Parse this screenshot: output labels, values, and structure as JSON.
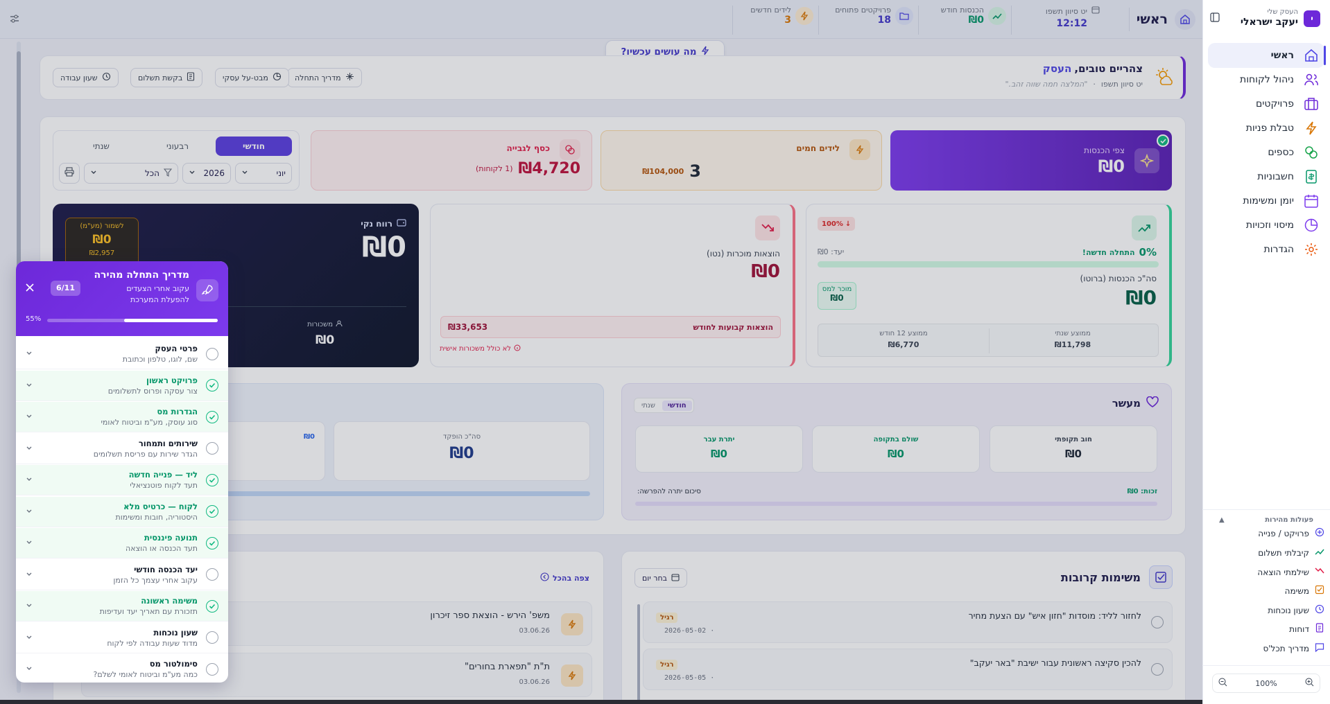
{
  "sidebar": {
    "business_label": "העסק שלי",
    "business_name": "יעקב ישראלי",
    "avatar": "י",
    "nav": [
      {
        "label": "ראשי",
        "icon": "home-icon"
      },
      {
        "label": "ניהול לקוחות",
        "icon": "users-icon"
      },
      {
        "label": "פרויקטים",
        "icon": "briefcase-icon"
      },
      {
        "label": "טבלת פניות",
        "icon": "bolt-icon"
      },
      {
        "label": "כספים",
        "icon": "coins-icon"
      },
      {
        "label": "חשבוניות",
        "icon": "invoice-icon"
      },
      {
        "label": "יומן ומשימות",
        "icon": "calendar-icon"
      },
      {
        "label": "מיסוי וזכויות",
        "icon": "pie-icon"
      },
      {
        "label": "הגדרות",
        "icon": "gear-icon"
      }
    ],
    "quick_title": "פעולות מהירות",
    "quick": [
      {
        "label": "פרויקט / פנייה",
        "icon": "plus-circle-icon"
      },
      {
        "label": "קיבלתי תשלום",
        "icon": "trend-up-icon"
      },
      {
        "label": "שילמתי הוצאה",
        "icon": "trend-down-icon"
      },
      {
        "label": "משימה",
        "icon": "task-icon"
      },
      {
        "label": "שעון נוכחות",
        "icon": "clock-icon"
      },
      {
        "label": "דוחות",
        "icon": "report-icon"
      },
      {
        "label": "מדריך תכל'ס",
        "icon": "chat-icon"
      }
    ],
    "zoom": "100%"
  },
  "topbar": {
    "title": "ראשי",
    "stats": [
      {
        "label": "יט סיוון תשפו",
        "value": "12:12"
      },
      {
        "label": "הכנסות חודש",
        "value": "₪0"
      },
      {
        "label": "פרויקטים פתוחים",
        "value": "18"
      },
      {
        "label": "לידים חדשים",
        "value": "3"
      }
    ],
    "floating": "מה עושים עכשיו?"
  },
  "greeting": {
    "title": "צהריים טובים,",
    "name": "העסק",
    "date": "יט סיוון תשפו",
    "quote": "\"המלצה חמה שווה זהב.\"",
    "buttons": [
      "מדריך התחלה",
      "מבט-על עסקי",
      "בקשת תשלום",
      "שעון עבודה"
    ]
  },
  "kpis": {
    "income": {
      "label": "צפי הכנסות",
      "value": "₪0"
    },
    "leads": {
      "label": "לידים חמים",
      "value": "3",
      "sub": "₪104,000"
    },
    "collect": {
      "label": "כסף לגבייה",
      "value": "₪4,720",
      "sub": "(1 לקוחות)"
    }
  },
  "period": {
    "tabs": [
      "חודשי",
      "רבעוני",
      "שנתי"
    ],
    "month": "יוני",
    "year": "2026",
    "filter": "הכל"
  },
  "income_card": {
    "pct": "0%",
    "new_label": "התחלה חדשה!",
    "target": "יעד: ₪0",
    "gross_label": "סה\"כ הכנסות (ברוטו)",
    "gross": "₪0",
    "sold_label": "מוכר למס",
    "sold": "₪0",
    "badge": "100%",
    "avg_year_label": "ממוצע שנתי",
    "avg_year": "₪11,798",
    "avg12_label": "ממוצע 12 חודש",
    "avg12": "₪6,770"
  },
  "expense_card": {
    "label": "הוצאות מוכרות (נטו)",
    "value": "₪0",
    "fixed_label": "הוצאות קבועות לחודש",
    "fixed": "₪33,653",
    "note": "לא כולל משכורות אישית"
  },
  "profit_card": {
    "label": "רווח נקי",
    "value": "₪0",
    "save_label": "לשמור (מע\"מ)",
    "save": "₪0",
    "save_sub": "₪2,957",
    "salary_label": "משכורות",
    "salary": "₪0"
  },
  "maaser": {
    "title": "מעשר",
    "tabs": [
      "חודשי",
      "שנתי"
    ],
    "cells": [
      {
        "label": "חוב תקופתי",
        "value": "₪0"
      },
      {
        "label": "שולם בתקופה",
        "value": "₪0"
      },
      {
        "label": "יתרת עבר",
        "value": "₪0"
      }
    ],
    "credit": "זכות: ₪0",
    "summary": "סיכום יתרה להפרשה:"
  },
  "deposit": {
    "label": "סה\"כ הופקד",
    "value": "₪0",
    "side": "₪0"
  },
  "tasks": {
    "title": "משימות קרובות",
    "pick_day": "בחר יום",
    "items": [
      {
        "title": "לחזור לליד: מוסדות \"חזון איש\" עם הצעת מחיר",
        "date": "2026-05-02",
        "tag": "רגיל"
      },
      {
        "title": "להכין סקיצה ראשונית עבור ישיבת \"באר יעקב\"",
        "date": "2026-05-05",
        "tag": "רגיל"
      }
    ]
  },
  "projects": {
    "view_all": "צפה בהכל",
    "items": [
      {
        "title": "משפ' הירש - הוצאת ספר זיכרון",
        "date": "03.06.26"
      },
      {
        "title": "ת\"ת \"תפארת בחורים\"",
        "date": "03.06.26"
      }
    ]
  },
  "guide": {
    "title": "מדריך התחלה מהירה",
    "subtitle": "עקוב אחרי הצעדים להפעלת המערכת",
    "count": "6/11",
    "pct": "55%",
    "progress": 0.55,
    "steps": [
      {
        "title": "פרטי העסק",
        "desc": "שם, לוגו, טלפון וכתובת",
        "done": false
      },
      {
        "title": "פרויקט ראשון",
        "desc": "צור עסקה ופרוס לתשלומים",
        "done": true
      },
      {
        "title": "הגדרות מס",
        "desc": "סוג עוסק, מע\"מ וביטוח לאומי",
        "done": true
      },
      {
        "title": "שירותים ותמחור",
        "desc": "הגדר שירות עם פריסת תשלומים",
        "done": false
      },
      {
        "title": "ליד — פנייה חדשה",
        "desc": "תעד לקוח פוטנציאלי",
        "done": true
      },
      {
        "title": "לקוח — כרטיס מלא",
        "desc": "היסטוריה, חובות ומשימות",
        "done": true
      },
      {
        "title": "תנועה פיננסית",
        "desc": "תעד הכנסה או הוצאה",
        "done": true
      },
      {
        "title": "יעד הכנסה חודשי",
        "desc": "עקוב אחרי עצמך כל הזמן",
        "done": false
      },
      {
        "title": "משימה ראשונה",
        "desc": "תזכורת עם תאריך יעד ועדיפות",
        "done": true
      },
      {
        "title": "שעון נוכחות",
        "desc": "מדוד שעות עבודה לפי לקוח",
        "done": false
      },
      {
        "title": "סימולטור מס",
        "desc": "כמה מע\"מ וביטוח לאומי לשלם?",
        "done": false
      }
    ]
  }
}
